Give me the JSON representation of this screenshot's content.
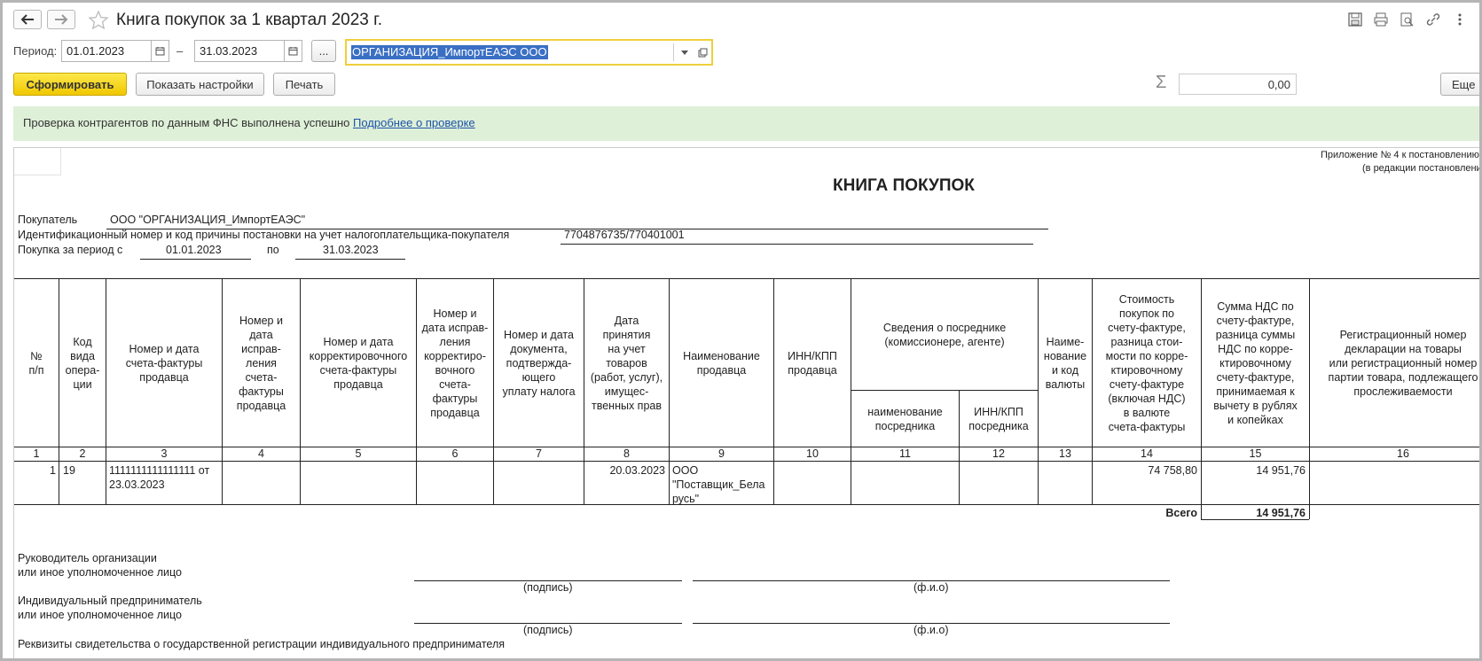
{
  "window": {
    "title": "Книга покупок за 1 квартал 2023 г."
  },
  "form": {
    "period_label": "Период:",
    "date_from": "01.01.2023",
    "dash": "–",
    "date_to": "31.03.2023",
    "more_btn": "...",
    "organization": "ОРГАНИЗАЦИЯ_ИмпортЕАЭС ООО"
  },
  "toolbar": {
    "generate": "Сформировать",
    "show_settings": "Показать настройки",
    "print": "Печать",
    "sum_symbol": "Σ",
    "sum_value": "0,00",
    "more": "Еще"
  },
  "banner": {
    "text": "Проверка контрагентов по данным ФНС выполнена успешно",
    "link": "Подробнее о проверке"
  },
  "report": {
    "appendix_1": "Приложение № 4 к постановлению",
    "appendix_2": "(в редакции постановлени",
    "title": "КНИГА ПОКУПОК",
    "buyer_label": "Покупатель",
    "buyer_value": "ООО \"ОРГАНИЗАЦИЯ_ИмпортЕАЭС\"",
    "inn_label": "Идентификационный номер и код причины постановки на учет налогоплательщика-покупателя",
    "inn_value": "7704876735/770401001",
    "period_label": "Покупка за период с",
    "period_from": "01.01.2023",
    "period_to_label": "по",
    "period_to": "31.03.2023",
    "headers": {
      "c1": "№\nп/п",
      "c2": "Код\nвида\nопера-\nции",
      "c3": "Номер и дата\nсчета-фактуры\nпродавца",
      "c4": "Номер и\nдата\nисправ-\nления\nсчета-\nфактуры\nпродавца",
      "c5": "Номер и дата\nкорректировочного\nсчета-фактуры\nпродавца",
      "c6": "Номер и\nдата исправ-\nления\nкорректиро-\nвочного\nсчета-\nфактуры\nпродавца",
      "c7": "Номер и дата\nдокумента,\nподтвержда-\nющего\nуплату налога",
      "c8": "Дата\nпринятия\nна учет\nтоваров\n(работ, услуг),\nимущес-\nтвенных прав",
      "c9": "Наименование\nпродавца",
      "c10": "ИНН/КПП\nпродавца",
      "c11_12": "Сведения о посреднике\n(комиссионере, агенте)",
      "c11": "наименование\nпосредника",
      "c12": "ИНН/КПП\nпосредника",
      "c13": "Наиме-\nнование\nи код\nвалюты",
      "c14": "Стоимость\nпокупок по\nсчету-фактуре,\nразница стои-\nмости по корре-\nктировочному\nсчету-фактуре\n(включая НДС)\nв валюте\nсчета-фактуры",
      "c15": "Сумма НДС по\nсчету-фактуре,\nразница суммы\nНДС по корре-\nктировочному\nсчету-фактуре,\nпринимаемая к\nвычету в рублях\nи копейках",
      "c16": "Регистрационный номер\nдекларации на товары\nили регистрационный номер\nпартии товара, подлежащего\nпрослеживаемости"
    },
    "col_numbers": [
      "1",
      "2",
      "3",
      "4",
      "5",
      "6",
      "7",
      "8",
      "9",
      "10",
      "11",
      "12",
      "13",
      "14",
      "15",
      "16"
    ],
    "row": {
      "n": "1",
      "code": "19",
      "invoice": "1111111111111111 от\n23.03.2023",
      "accept_date": "20.03.2023",
      "seller": "ООО\n\"Поставщик_Бела\nрусь\"",
      "cost": "74 758,80",
      "vat": "14 951,76"
    },
    "total_label": "Всего",
    "total_vat": "14 951,76",
    "sign": {
      "head_1": "Руководитель организации",
      "head_2": "или иное уполномоченное лицо",
      "signature": "(подпись)",
      "fio": "(ф.и.о)",
      "ip_1": "Индивидуальный предприниматель",
      "ip_2": "или иное уполномоченное лицо",
      "requisites": "Реквизиты свидетельства о государственной регистрации индивидуального предпринимателя"
    }
  }
}
